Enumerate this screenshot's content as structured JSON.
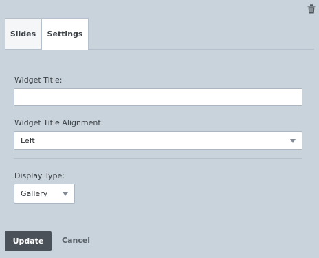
{
  "tabs": [
    {
      "label": "Slides",
      "active": false
    },
    {
      "label": "Settings",
      "active": true
    }
  ],
  "form": {
    "widget_title_label": "Widget Title:",
    "widget_title_value": "",
    "alignment_label": "Widget Title Alignment:",
    "alignment_value": "Left",
    "display_type_label": "Display Type:",
    "display_type_value": "Gallery"
  },
  "actions": {
    "update_label": "Update",
    "cancel_label": "Cancel"
  },
  "icons": {
    "delete": "trash-icon"
  },
  "colors": {
    "background": "#c9d3dc",
    "primary_button": "#4a5158"
  }
}
